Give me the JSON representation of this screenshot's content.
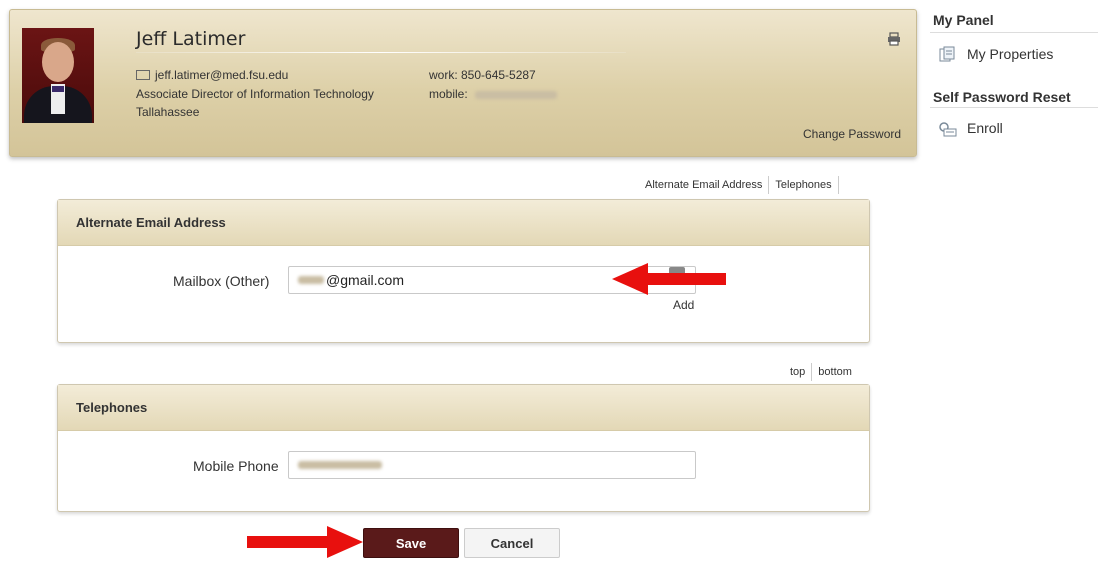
{
  "profile": {
    "name": "Jeff Latimer",
    "email": "jeff.latimer@med.fsu.edu",
    "title": "Associate Director of Information Technology",
    "location": "Tallahassee",
    "work_phone": "work: 850-645-5287",
    "mobile_label": "mobile:",
    "change_password": "Change Password",
    "print_icon": "printer-icon"
  },
  "right_panel": {
    "my_panel_heading": "My Panel",
    "my_properties": "My Properties",
    "self_reset_heading": "Self Password Reset",
    "enroll": "Enroll"
  },
  "anchor_nav_top": {
    "alt_email": "Alternate Email Address",
    "telephones": "Telephones"
  },
  "anchor_nav_bottom": {
    "top": "top",
    "bottom": "bottom"
  },
  "alt_email_section": {
    "title": "Alternate Email Address",
    "field_label": "Mailbox (Other)",
    "field_value": "@gmail.com",
    "add_label": "Add"
  },
  "telephones_section": {
    "title": "Telephones",
    "field_label": "Mobile Phone"
  },
  "actions": {
    "save": "Save",
    "cancel": "Cancel"
  },
  "colors": {
    "accent_arrow": "#e8100e",
    "save_button": "#5a1a1a",
    "header_tan": "#ddd0a8"
  }
}
